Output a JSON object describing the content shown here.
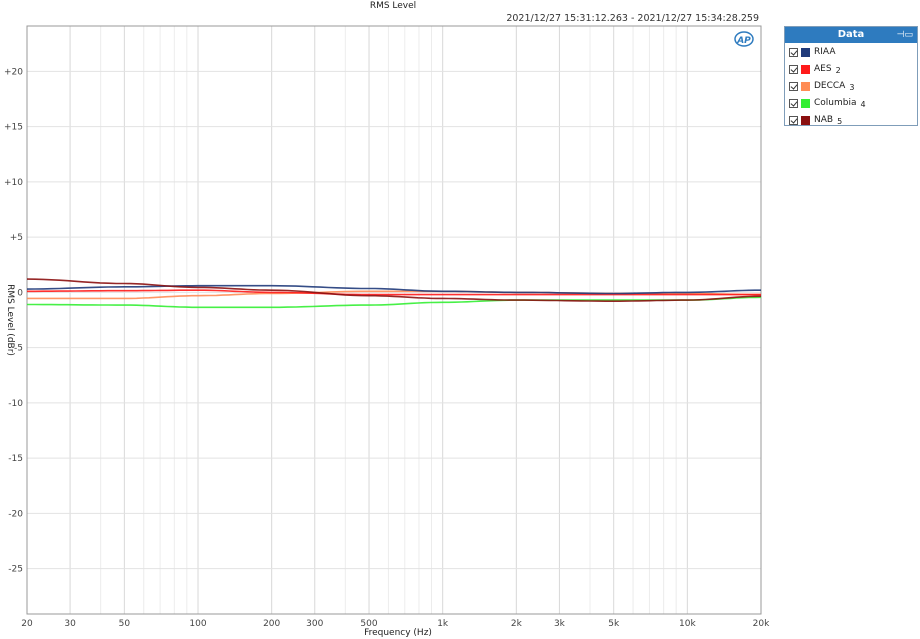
{
  "header": {
    "title": "RMS Level",
    "timestamp": "2021/12/27 15:31:12.263 - 2021/12/27 15:34:28.259",
    "logo": "AP"
  },
  "legend": {
    "title": "Data",
    "pin_icon": "pin-icon",
    "items": [
      {
        "label": "RIAA",
        "num": "",
        "color": "#1f3a7a",
        "checked": true
      },
      {
        "label": "AES",
        "num": "2",
        "color": "#ff1a1a",
        "checked": true
      },
      {
        "label": "DECCA",
        "num": "3",
        "color": "#ff8c55",
        "checked": true
      },
      {
        "label": "Columbia",
        "num": "4",
        "color": "#33ee33",
        "checked": true
      },
      {
        "label": "NAB",
        "num": "5",
        "color": "#8b1010",
        "checked": true
      }
    ]
  },
  "chart_data": {
    "type": "line",
    "title": "RMS Level",
    "xlabel": "Frequency (Hz)",
    "ylabel": "RMS Level (dBr)",
    "xscale": "log",
    "xlim": [
      20,
      20000
    ],
    "ylim": [
      -29.1,
      24.1
    ],
    "grid": true,
    "legend_position": "right",
    "x_ticks": [
      {
        "value": 20,
        "label": "20"
      },
      {
        "value": 30,
        "label": "30"
      },
      {
        "value": 50,
        "label": "50"
      },
      {
        "value": 100,
        "label": "100"
      },
      {
        "value": 200,
        "label": "200"
      },
      {
        "value": 300,
        "label": "300"
      },
      {
        "value": 500,
        "label": "500"
      },
      {
        "value": 1000,
        "label": "1k"
      },
      {
        "value": 2000,
        "label": "2k"
      },
      {
        "value": 3000,
        "label": "3k"
      },
      {
        "value": 5000,
        "label": "5k"
      },
      {
        "value": 10000,
        "label": "10k"
      },
      {
        "value": 20000,
        "label": "20k"
      }
    ],
    "x_minor_grid": [
      40,
      60,
      70,
      80,
      90,
      400,
      600,
      700,
      800,
      900,
      4000,
      6000,
      7000,
      8000,
      9000
    ],
    "y_ticks": [
      {
        "value": 20,
        "label": "+20"
      },
      {
        "value": 15,
        "label": "+15"
      },
      {
        "value": 10,
        "label": "+10"
      },
      {
        "value": 5,
        "label": "+5"
      },
      {
        "value": 0,
        "label": "0"
      },
      {
        "value": -5,
        "label": "-5"
      },
      {
        "value": -10,
        "label": "-10"
      },
      {
        "value": -15,
        "label": "-15"
      },
      {
        "value": -20,
        "label": "-20"
      },
      {
        "value": -25,
        "label": "-25"
      }
    ],
    "x": [
      20,
      50,
      100,
      200,
      500,
      1000,
      2000,
      5000,
      10000,
      20000
    ],
    "series": [
      {
        "name": "RIAA",
        "color": "#1f3a7a",
        "values": [
          0.3,
          0.5,
          0.6,
          0.6,
          0.35,
          0.1,
          0.0,
          -0.1,
          0.0,
          0.2
        ]
      },
      {
        "name": "AES",
        "color": "#ff1a1a",
        "values": [
          0.1,
          0.15,
          0.2,
          0.0,
          -0.2,
          -0.2,
          -0.2,
          -0.2,
          -0.2,
          -0.2
        ]
      },
      {
        "name": "DECCA",
        "color": "#ff8c55",
        "values": [
          -0.55,
          -0.55,
          -0.3,
          -0.1,
          0.1,
          0.1,
          0.0,
          -0.1,
          -0.1,
          -0.2
        ]
      },
      {
        "name": "Columbia",
        "color": "#33ee33",
        "values": [
          -1.1,
          -1.15,
          -1.35,
          -1.35,
          -1.15,
          -0.9,
          -0.7,
          -0.7,
          -0.7,
          -0.45
        ]
      },
      {
        "name": "NAB",
        "color": "#8b1010",
        "values": [
          1.2,
          0.8,
          0.45,
          0.2,
          -0.3,
          -0.55,
          -0.7,
          -0.8,
          -0.7,
          -0.35
        ]
      }
    ]
  }
}
